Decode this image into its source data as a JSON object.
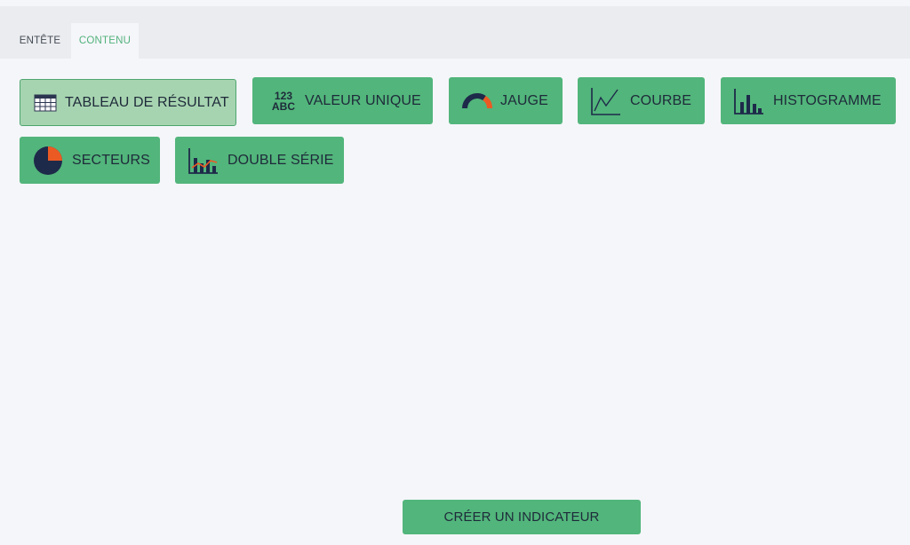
{
  "tabs": [
    {
      "label": "ENTÊTE",
      "active": false
    },
    {
      "label": "CONTENU",
      "active": true
    }
  ],
  "types": {
    "table": {
      "label": "TABLEAU DE RÉSULTAT",
      "icon": "table-grid-icon",
      "selected": true
    },
    "single_value": {
      "label": "VALEUR UNIQUE",
      "icon": "number-text-icon",
      "icon_text_top": "123",
      "icon_text_bottom": "ABC"
    },
    "gauge": {
      "label": "JAUGE",
      "icon": "gauge-icon"
    },
    "curve": {
      "label": "COURBE",
      "icon": "line-chart-icon"
    },
    "histogram": {
      "label": "HISTOGRAMME",
      "icon": "bar-chart-icon"
    },
    "sectors": {
      "label": "SECTEURS",
      "icon": "pie-chart-icon"
    },
    "double_series": {
      "label": "DOUBLE SÉRIE",
      "icon": "combo-chart-icon"
    }
  },
  "actions": {
    "create_label": "CRÉER UN INDICATEUR"
  },
  "colors": {
    "accent_green": "#52b57b",
    "selected_green": "#a7d4b0",
    "icon_navy": "#1e2a4a",
    "icon_orange": "#ec5a24",
    "active_tab_text": "#52b27c"
  }
}
